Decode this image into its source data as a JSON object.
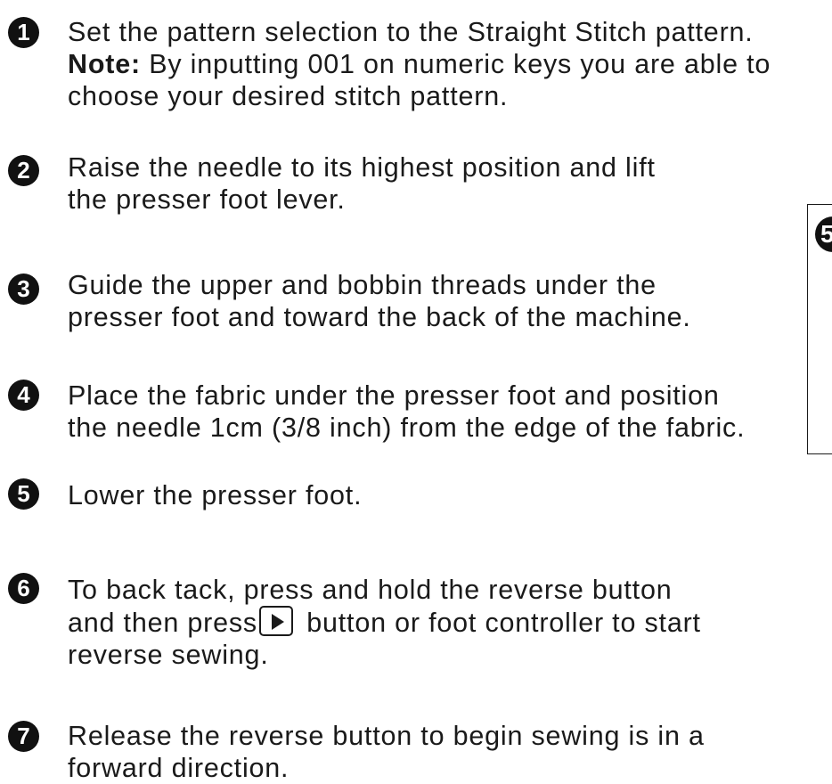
{
  "steps": [
    {
      "number": "1",
      "line1": "Set the pattern selection to the Straight Stitch pattern.",
      "note_label": "Note:",
      "note_text": " By inputting 001 on numeric keys you are able to",
      "line3": "choose your desired stitch pattern."
    },
    {
      "number": "2",
      "line1": "Raise the needle to its highest position and lift",
      "line2": "the presser foot lever."
    },
    {
      "number": "3",
      "line1": "Guide the upper and bobbin threads under the",
      "line2": "presser foot and toward the back of the machine."
    },
    {
      "number": "4",
      "line1": "Place the fabric under the presser foot and position",
      "line2": "the needle 1cm (3/8 inch) from the edge of the fabric."
    },
    {
      "number": "5",
      "line1": "Lower the presser foot."
    },
    {
      "number": "6",
      "line1": "To back tack, press and hold the reverse button",
      "line2_before": "and then press",
      "line2_after": " button or foot controller to start",
      "line3": "reverse sewing."
    },
    {
      "number": "7",
      "line1": "Release the reverse button to begin sewing is in a",
      "line2": "forward direction."
    }
  ],
  "side_panel": {
    "badge": "5"
  },
  "icons": {
    "start_button": "play-button-icon"
  }
}
